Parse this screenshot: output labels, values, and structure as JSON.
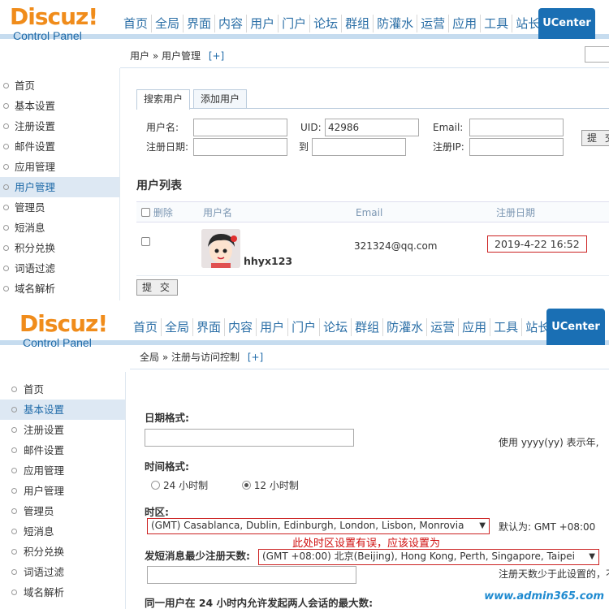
{
  "logo": {
    "word": "Discuz!",
    "sub": "Control Panel"
  },
  "nav": [
    "首页",
    "全局",
    "界面",
    "内容",
    "用户",
    "门户",
    "论坛",
    "群组",
    "防灌水",
    "运营",
    "应用",
    "工具",
    "站长"
  ],
  "uc_tab": "UCenter",
  "panel1": {
    "breadcrumb": "用户 » 用户管理",
    "breadcrumb_plus": "[+]",
    "sidebar": [
      "首页",
      "基本设置",
      "注册设置",
      "邮件设置",
      "应用管理",
      "用户管理",
      "管理员",
      "短消息",
      "积分兑换",
      "词语过滤",
      "域名解析"
    ],
    "sidebar_active": "用户管理",
    "tabs": [
      "搜索用户",
      "添加用户"
    ],
    "form": {
      "username_label": "用户名:",
      "uid_label": "UID:",
      "uid_value": "42986",
      "email_label": "Email:",
      "regdate_label": "注册日期:",
      "to_label": "到",
      "regip_label": "注册IP:",
      "submit": "提 交"
    },
    "list_title": "用户列表",
    "table": {
      "headers": [
        "删除",
        "用户名",
        "Email",
        "注册日期"
      ],
      "rows": [
        {
          "username": "hhyx123",
          "email": "321324@qq.com",
          "regdate": "2019-4-22 16:52"
        }
      ]
    },
    "submit": "提 交"
  },
  "panel2": {
    "breadcrumb": "全局 » 注册与访问控制",
    "breadcrumb_plus": "[+]",
    "sidebar": [
      "首页",
      "基本设置",
      "注册设置",
      "邮件设置",
      "应用管理",
      "用户管理",
      "管理员",
      "短消息",
      "积分兑换",
      "词语过滤",
      "域名解析"
    ],
    "sidebar_active": "基本设置",
    "date_format_label": "日期格式:",
    "date_format_hint": "使用 yyyy(yy) 表示年,",
    "time_format_label": "时间格式:",
    "time_24": "24 小时制",
    "time_12": "12 小时制",
    "timezone_label": "时区:",
    "timezone_value": "(GMT) Casablanca, Dublin, Edinburgh, London, Lisbon, Monrovia",
    "timezone_default": "默认为: GMT +08:00",
    "timezone_note": "此处时区设置有误，应该设置为",
    "pm_min_days_label": "发短消息最少注册天数:",
    "timezone_correct": "(GMT +08:00) 北京(Beijing), Hong Kong, Perth, Singapore, Taipei",
    "pm_min_days_hint": "注册天数少于此设置的，不",
    "max_conv_label": "同一用户在 24 小时内允许发起两人会话的最大数:",
    "watermark": "www.admin365.com"
  }
}
